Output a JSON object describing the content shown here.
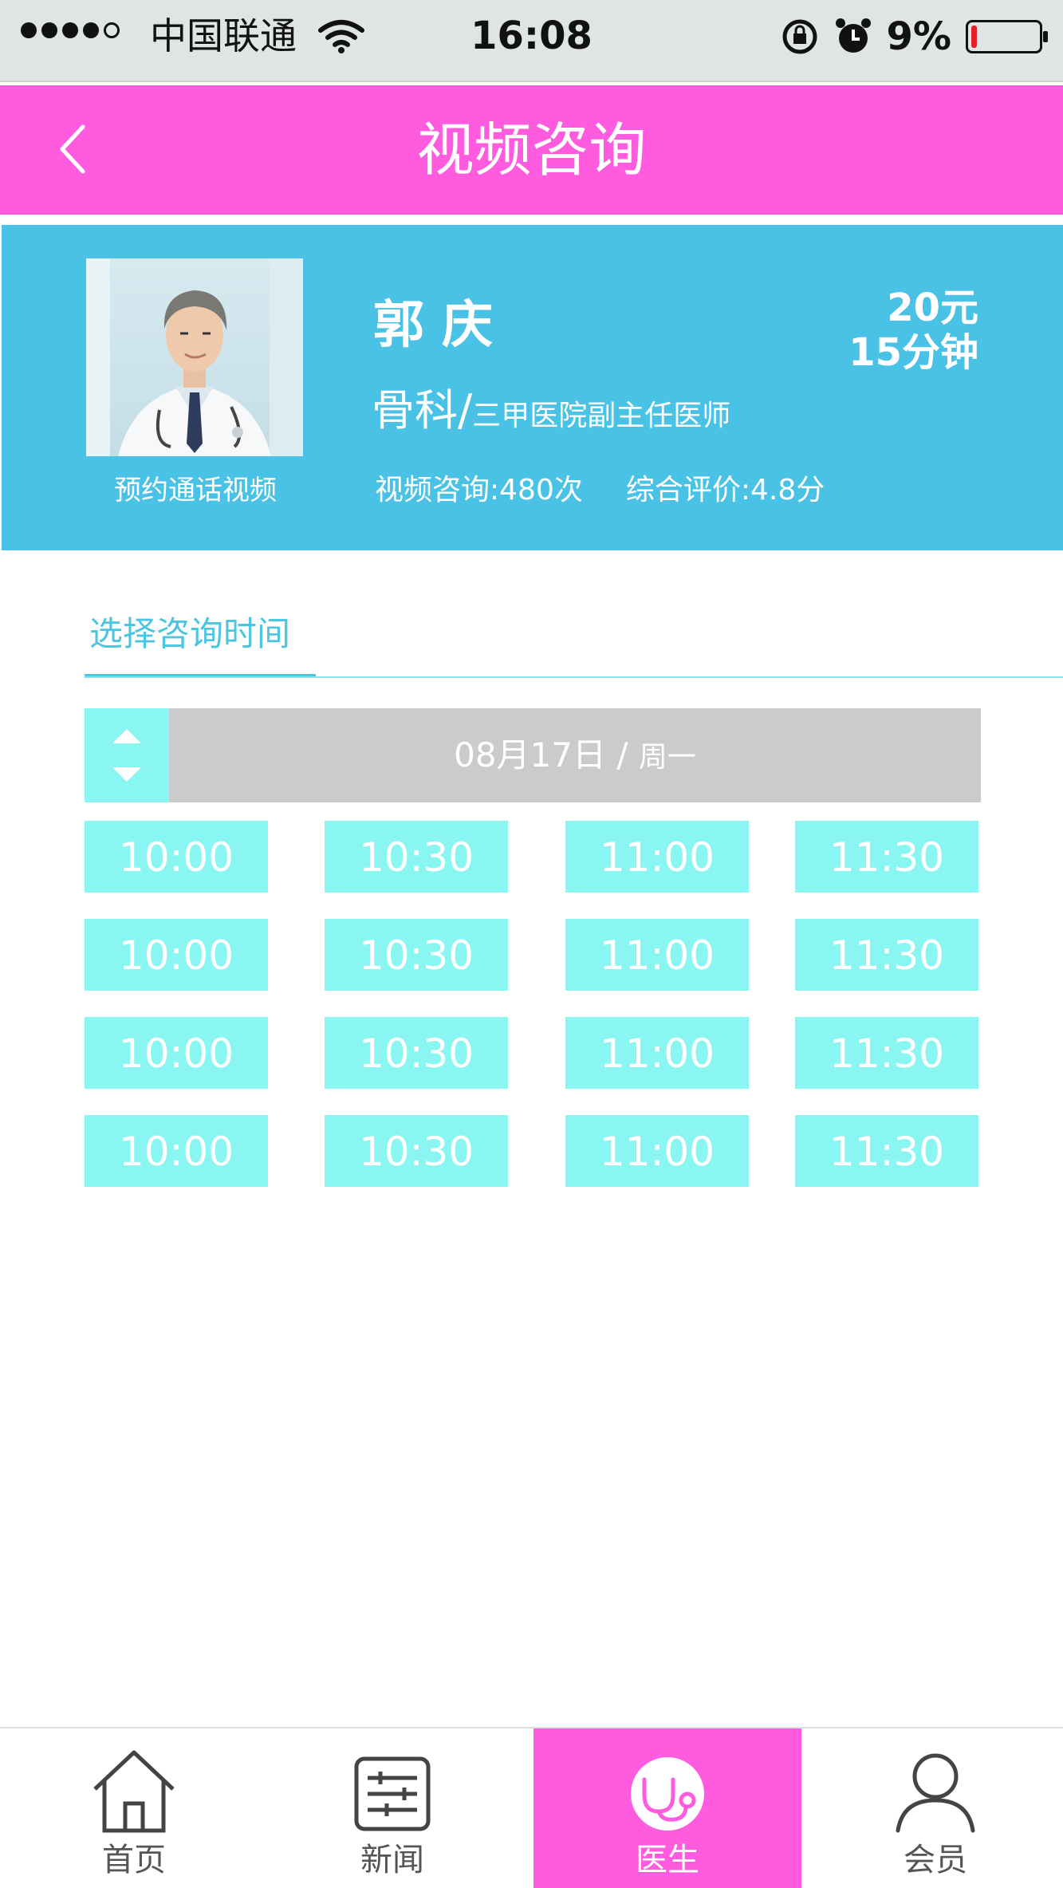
{
  "status_bar": {
    "carrier": "中国联通",
    "time": "16:08",
    "battery": "9%",
    "battery_fraction": 0.09
  },
  "nav": {
    "title": "视频咨询",
    "back_icon": "chevron-left-icon"
  },
  "doctor": {
    "name": "郭庆",
    "department": "骨科",
    "separator": "/",
    "title": "三甲医院副主任医师",
    "price": "20元",
    "duration": "15分钟",
    "appointment_label": "预约通话视频",
    "consult_count": "视频咨询:480次",
    "rating": "综合评价:4.8分"
  },
  "section": {
    "tab_label": "选择咨询时间"
  },
  "date_selector": {
    "date": "08月17日",
    "separator": "/",
    "weekday": "周一"
  },
  "time_slots": [
    [
      "10:00",
      "10:30",
      "11:00",
      "11:30"
    ],
    [
      "10:00",
      "10:30",
      "11:00",
      "11:30"
    ],
    [
      "10:00",
      "10:30",
      "11:00",
      "11:30"
    ],
    [
      "10:00",
      "10:30",
      "11:00",
      "11:30"
    ]
  ],
  "tab_bar": [
    {
      "label": "首页",
      "icon": "home-icon",
      "active": false
    },
    {
      "label": "新闻",
      "icon": "news-icon",
      "active": false
    },
    {
      "label": "医生",
      "icon": "stethoscope-icon",
      "active": true
    },
    {
      "label": "会员",
      "icon": "user-icon",
      "active": false
    }
  ],
  "colors": {
    "accent_pink": "#ff5bde",
    "card_blue": "#4ac2e6",
    "slot_cyan": "#8af6f2",
    "date_gray": "#cbcbcb"
  }
}
